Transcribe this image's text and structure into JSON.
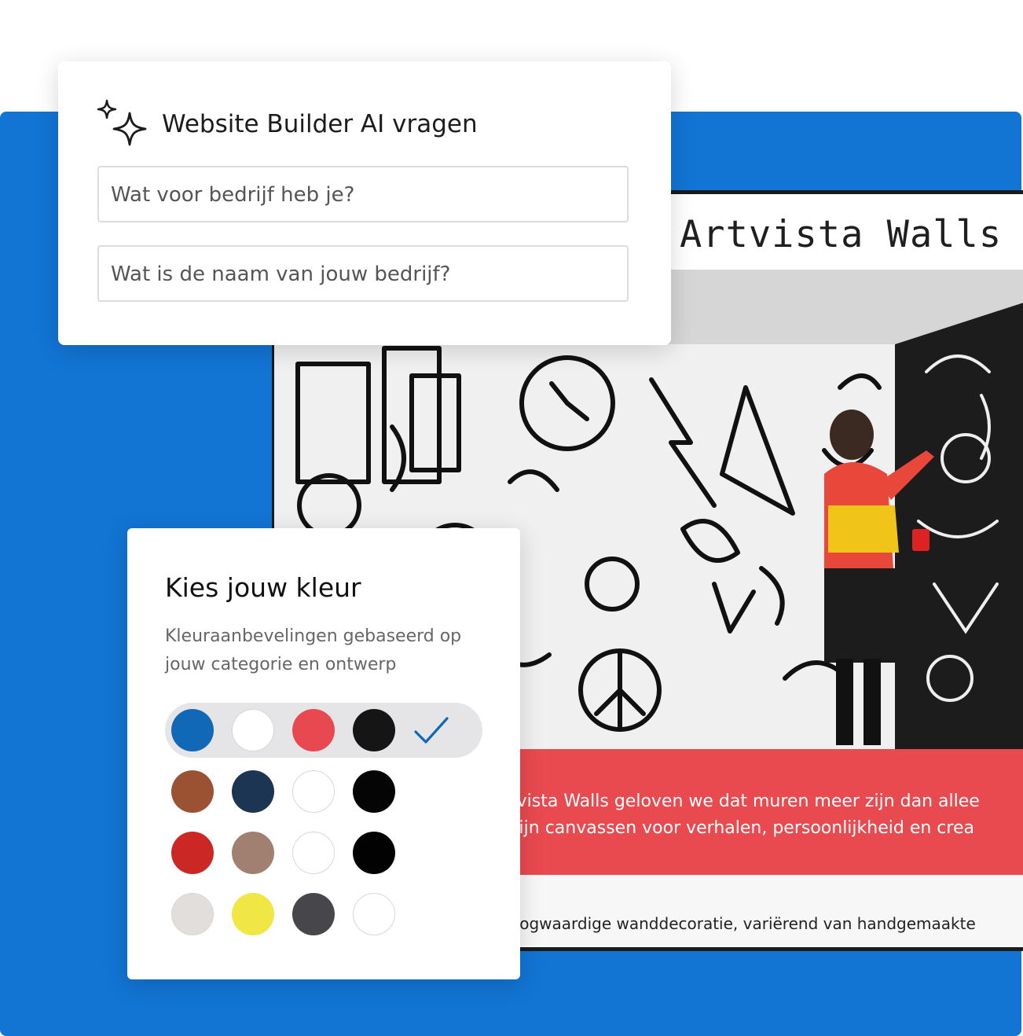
{
  "ai_card": {
    "title": "Website Builder AI vragen",
    "question_1": "Wat voor bedrijf heb je?",
    "question_2": "Wat is de naam van jouw bedrijf?"
  },
  "site_preview": {
    "site_title": "Artvista Walls",
    "banner_line_1": "tvista Walls geloven we dat muren meer zijn dan allee",
    "banner_line_2": "zijn canvassen voor verhalen, persoonlijkheid en crea",
    "footer_line": "oogwaardige wanddecoratie, variërend van handgemaakte",
    "colors": {
      "banner": "#e84a50",
      "panel": "#1274d3"
    }
  },
  "color_card": {
    "title": "Kies jouw kleur",
    "subtitle": "Kleuraanbevelingen gebaseerd op jouw categorie en ontwerp",
    "selected_palette": [
      "#1168b7",
      "#ffffff",
      "#e8484f",
      "#151515"
    ],
    "selected_icon": "checkmark-icon",
    "palettes": [
      [
        "#9b5232",
        "#1b3553",
        "#ffffff",
        "#050505"
      ],
      [
        "#cb2825",
        "#a17f71",
        "#ffffff",
        "#020202"
      ],
      [
        "#e2dedb",
        "#f0e744",
        "#47464b",
        "#ffffff"
      ]
    ]
  }
}
